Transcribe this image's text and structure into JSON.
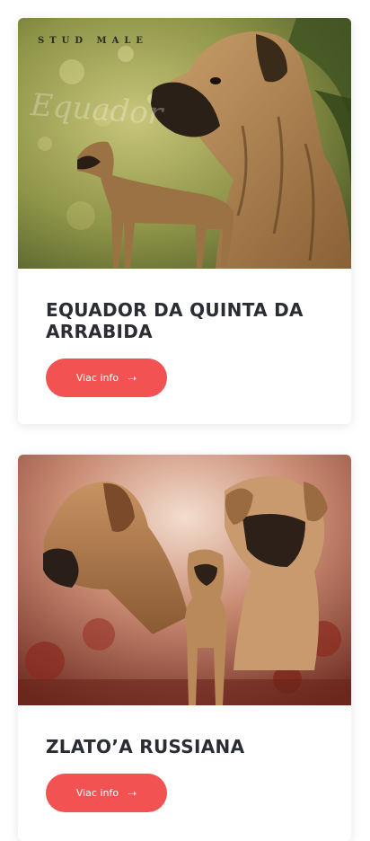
{
  "cards": [
    {
      "caption": "STUD MALE",
      "script_text": "Equador",
      "title": "EQUADOR DA QUINTA DA ARRABIDA",
      "button_label": "Viac info",
      "button_icon": "arrow-right-icon"
    },
    {
      "title": "ZLATO’A RUSSIANA",
      "button_label": "Viac info",
      "button_icon": "arrow-right-icon"
    }
  ],
  "colors": {
    "accent": "#f25252",
    "title": "#2b2d35",
    "photo1_bg": "#7f8a44",
    "photo2_bg": "#a65a4a"
  }
}
